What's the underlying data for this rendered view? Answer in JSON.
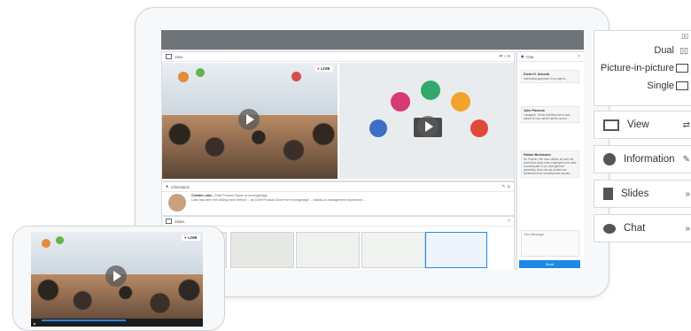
{
  "video_panel": {
    "title": "View",
    "live_label": "LIVE"
  },
  "chat_panel": {
    "title": "Chat",
    "messages": [
      {
        "name": "Dieter H. Schmitt",
        "text": "Interesting approach to my agent..."
      },
      {
        "name": "John Parsons",
        "text": "I disagree. I think that they are in fact aware of how useful videos can be..."
      },
      {
        "name": "Fabian Beckmann",
        "text": "Mr. Fischer: Yet, most of the..."
      },
      {
        "name": "",
        "text": "Mr. Fischer, We have offices all over the world that want every employee to be able to participate in our next general assembly. How can we protect our livestream from unauthorized access..."
      }
    ],
    "input_placeholder": "Your Message",
    "send_label": "Send"
  },
  "info_panel": {
    "title": "Information",
    "presenter": "Christin Lüke",
    "role": "| Chief Product Owner at movingimage",
    "bio": "Lüke has been the driving force behind ... as Chief Product Owner for movingimage ... hands-on management experience ..."
  },
  "slides_panel": {
    "title": "Slides"
  },
  "layout_options": [
    {
      "label": "Dual"
    },
    {
      "label": "Picture-in-picture"
    },
    {
      "label": "Single"
    }
  ],
  "side_menu": [
    {
      "label": "View",
      "icon": "monitor-icon",
      "action": "swap-icon"
    },
    {
      "label": "Information",
      "icon": "info-icon",
      "action": "wrench-icon"
    },
    {
      "label": "Slides",
      "icon": "document-icon",
      "action": "double-chevron-down-icon"
    },
    {
      "label": "Chat",
      "icon": "chat-bubble-icon",
      "action": "double-chevron-right-icon"
    }
  ],
  "colors": {
    "accent": "#1e88e5",
    "live_dot": "#e53935",
    "topbar": "#6f7478"
  }
}
